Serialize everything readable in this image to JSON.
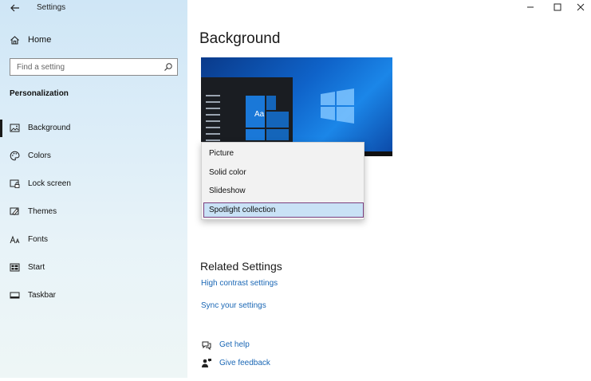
{
  "window": {
    "title": "Settings"
  },
  "sidebar": {
    "home_label": "Home",
    "search_placeholder": "Find a setting",
    "section_title": "Personalization",
    "items": [
      {
        "label": "Background",
        "icon": "picture-icon",
        "active": true
      },
      {
        "label": "Colors",
        "icon": "palette-icon",
        "active": false
      },
      {
        "label": "Lock screen",
        "icon": "lock-screen-icon",
        "active": false
      },
      {
        "label": "Themes",
        "icon": "themes-icon",
        "active": false
      },
      {
        "label": "Fonts",
        "icon": "fonts-icon",
        "active": false
      },
      {
        "label": "Start",
        "icon": "start-icon",
        "active": false
      },
      {
        "label": "Taskbar",
        "icon": "taskbar-icon",
        "active": false
      }
    ]
  },
  "main": {
    "page_title": "Background",
    "preview": {
      "tile_text": "Aa"
    },
    "dropdown": {
      "options": [
        "Picture",
        "Solid color",
        "Slideshow",
        "Spotlight collection"
      ],
      "selected": "Spotlight collection"
    },
    "related": {
      "title": "Related Settings",
      "links": [
        "High contrast settings",
        "Sync your settings"
      ]
    },
    "help": {
      "get_help": "Get help",
      "give_feedback": "Give feedback"
    }
  },
  "colors": {
    "accent": "#0f63c9",
    "link": "#1a67b5",
    "selection": "#c9e2f6",
    "selection_border": "#7b3f7e"
  }
}
